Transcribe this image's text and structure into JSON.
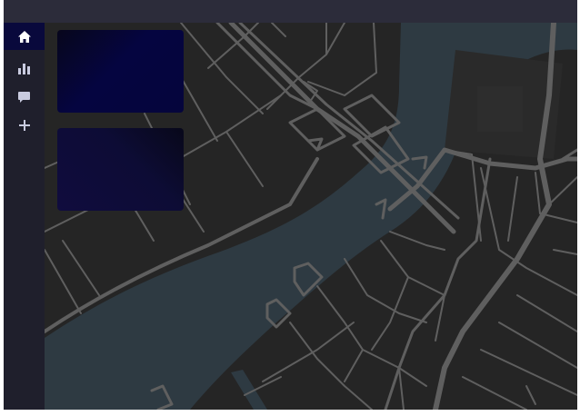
{
  "sidebar": {
    "items": [
      {
        "icon": "home-icon",
        "active": true
      },
      {
        "icon": "bar-chart-icon",
        "active": false
      },
      {
        "icon": "comment-icon",
        "active": false
      },
      {
        "icon": "plus-icon",
        "active": false
      }
    ]
  },
  "colors": {
    "sidebar_bg": "#1f1f2c",
    "active_bg": "#09093c",
    "icon": "#c9cbe0",
    "icon_active": "#ffffff",
    "water": "#2e3a42",
    "land": "#252525",
    "road": "#5f5f5f"
  },
  "panels": [
    {
      "name": "panel-top"
    },
    {
      "name": "panel-bottom"
    }
  ]
}
